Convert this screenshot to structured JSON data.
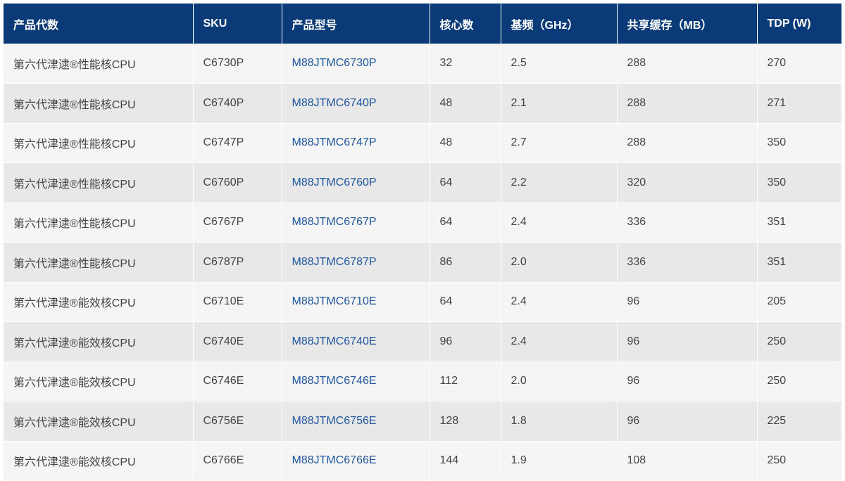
{
  "table": {
    "headers": [
      "产品代数",
      "SKU",
      "产品型号",
      "核心数",
      "基频（GHz）",
      "共享缓存（MB）",
      "TDP (W)"
    ],
    "rows": [
      [
        "第六代津逮®性能核CPU",
        "C6730P",
        "M88JTMC6730P",
        "32",
        "2.5",
        "288",
        "270"
      ],
      [
        "第六代津逮®性能核CPU",
        "C6740P",
        "M88JTMC6740P",
        "48",
        "2.1",
        "288",
        "271"
      ],
      [
        "第六代津逮®性能核CPU",
        "C6747P",
        "M88JTMC6747P",
        "48",
        "2.7",
        "288",
        "350"
      ],
      [
        "第六代津逮®性能核CPU",
        "C6760P",
        "M88JTMC6760P",
        "64",
        "2.2",
        "320",
        "350"
      ],
      [
        "第六代津逮®性能核CPU",
        "C6767P",
        "M88JTMC6767P",
        "64",
        "2.4",
        "336",
        "351"
      ],
      [
        "第六代津逮®性能核CPU",
        "C6787P",
        "M88JTMC6787P",
        "86",
        "2.0",
        "336",
        "351"
      ],
      [
        "第六代津逮®能效核CPU",
        "C6710E",
        "M88JTMC6710E",
        "64",
        "2.4",
        "96",
        "205"
      ],
      [
        "第六代津逮®能效核CPU",
        "C6740E",
        "M88JTMC6740E",
        "96",
        "2.4",
        "96",
        "250"
      ],
      [
        "第六代津逮®能效核CPU",
        "C6746E",
        "M88JTMC6746E",
        "112",
        "2.0",
        "96",
        "250"
      ],
      [
        "第六代津逮®能效核CPU",
        "C6756E",
        "M88JTMC6756E",
        "128",
        "1.8",
        "96",
        "225"
      ],
      [
        "第六代津逮®能效核CPU",
        "C6766E",
        "M88JTMC6766E",
        "144",
        "1.9",
        "108",
        "250"
      ]
    ]
  },
  "colors": {
    "header_bg": "#0a3b78",
    "header_text": "#ffffff",
    "row_odd": "#f5f5f5",
    "row_even": "#e8e8e8",
    "model_link": "#1f56a0",
    "body_text": "#444444"
  }
}
